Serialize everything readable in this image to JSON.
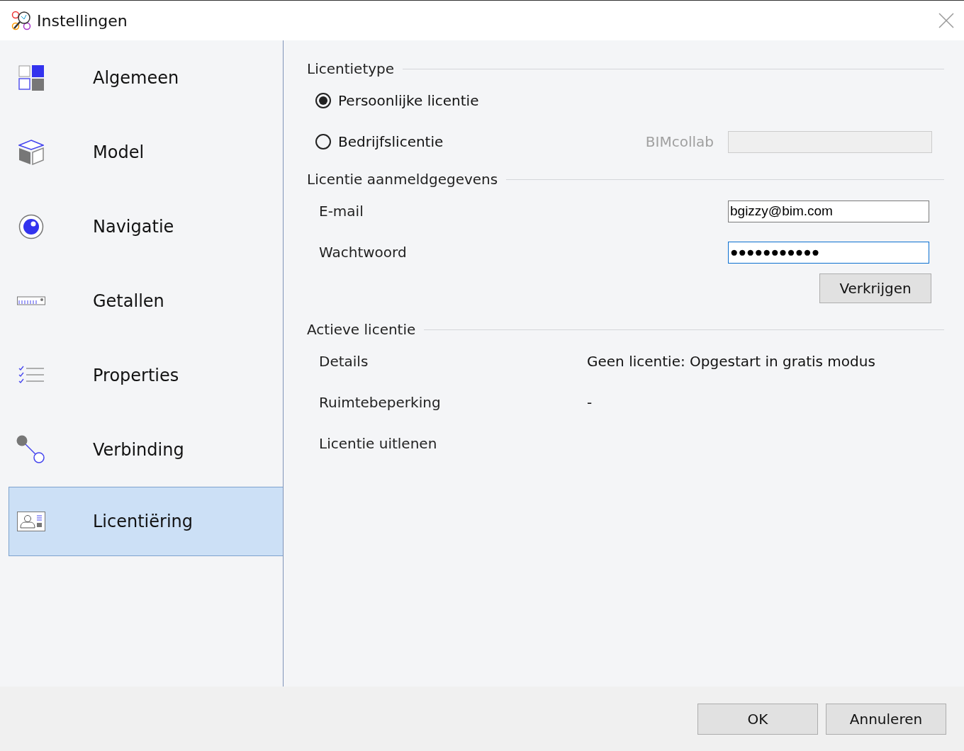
{
  "window": {
    "title": "Instellingen"
  },
  "sidebar": {
    "items": [
      {
        "label": "Algemeen",
        "selected": false
      },
      {
        "label": "Model",
        "selected": false
      },
      {
        "label": "Navigatie",
        "selected": false
      },
      {
        "label": "Getallen",
        "selected": false
      },
      {
        "label": "Properties",
        "selected": false
      },
      {
        "label": "Verbinding",
        "selected": false
      },
      {
        "label": "Licentiëring",
        "selected": true
      }
    ]
  },
  "license_type": {
    "heading": "Licentietype",
    "options": [
      {
        "label": "Persoonlijke licentie",
        "selected": true
      },
      {
        "label": "Bedrijfslicentie",
        "selected": false
      }
    ],
    "server_field": {
      "label": "BIMcollab",
      "disabled": true
    }
  },
  "credentials": {
    "heading": "Licentie aanmeldgegevens",
    "fields": [
      {
        "label": "E-mail",
        "value": "bgizzy@bim.com",
        "focused": false
      },
      {
        "label": "Wachtwoord",
        "value": "●●●●●●●●●●●",
        "focused": true
      }
    ],
    "button": "Verkrijgen"
  },
  "active_license": {
    "heading": "Actieve licentie",
    "rows": [
      {
        "label": "Details",
        "value": "Geen licentie: Opgestart in gratis modus"
      },
      {
        "label": "Ruimtebeperking",
        "value": "-"
      },
      {
        "label": "Licentie uitlenen"
      }
    ]
  },
  "footer": {
    "buttons": [
      "OK",
      "Annuleren"
    ]
  }
}
